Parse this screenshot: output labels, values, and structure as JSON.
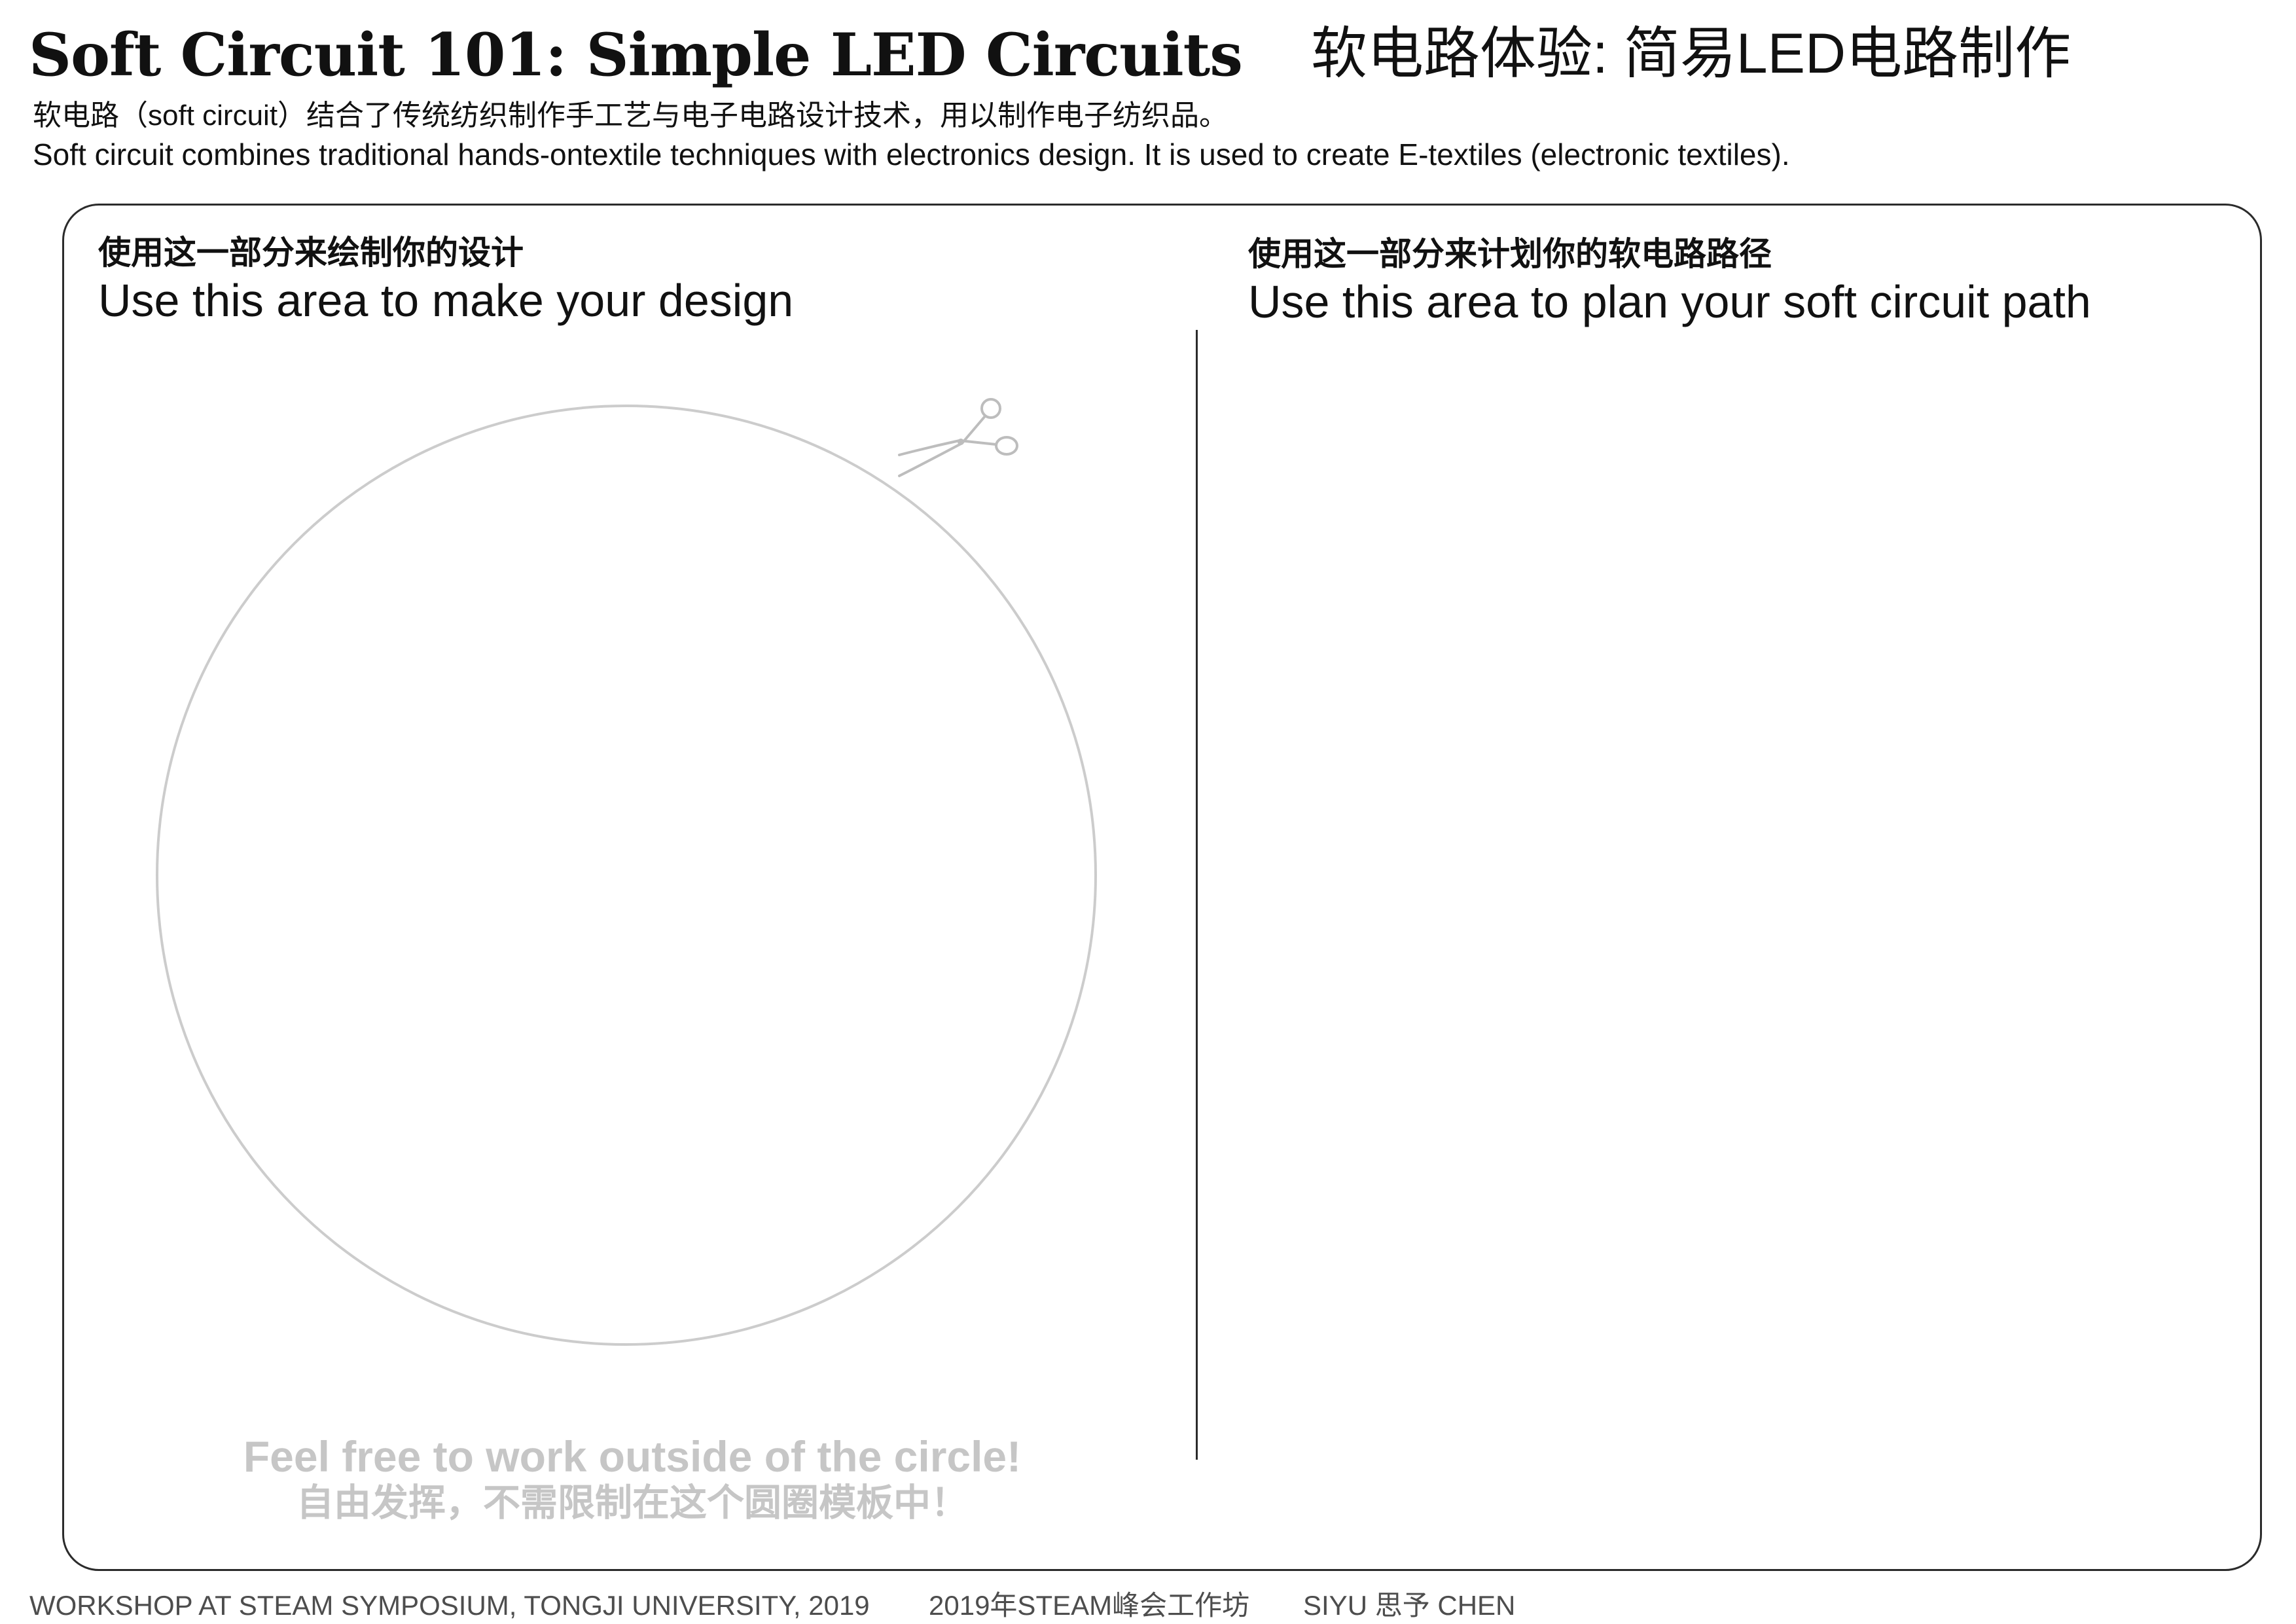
{
  "header": {
    "title_en": "Soft Circuit 101: Simple LED Circuits",
    "title_zh": "软电路体验: 简易LED电路制作",
    "intro_zh": "软电路（soft circuit）结合了传统纺织制作手工艺与电子电路设计技术，用以制作电子纺织品。",
    "intro_en": "Soft circuit combines traditional hands-ontextile techniques with electronics design. It is used to create E-textiles (electronic textiles)."
  },
  "design_area": {
    "label_zh": "使用这一部分来绘制你的设计",
    "label_en": "Use this area to make your design",
    "icon": "scissors-icon",
    "note_en": "Feel free to work outside of the circle!",
    "note_zh": "自由发挥，不需限制在这个圆圈模板中！"
  },
  "circuit_area": {
    "label_zh": "使用这一部分来计划你的软电路路径",
    "label_en": "Use this area to plan your soft circuit path"
  },
  "footer": {
    "event_en": "WORKSHOP AT STEAM SYMPOSIUM, TONGJI UNIVERSITY, 2019",
    "event_zh": "2019年STEAM峰会工作坊",
    "author": "SIYU 思予 CHEN"
  },
  "colors": {
    "text": "#111111",
    "frame": "#2b2b2b",
    "circle_outline": "#cccccc",
    "note_text": "#c6c6c6",
    "scissors": "#bdbdbd",
    "footer_text": "#4d4d4d"
  }
}
